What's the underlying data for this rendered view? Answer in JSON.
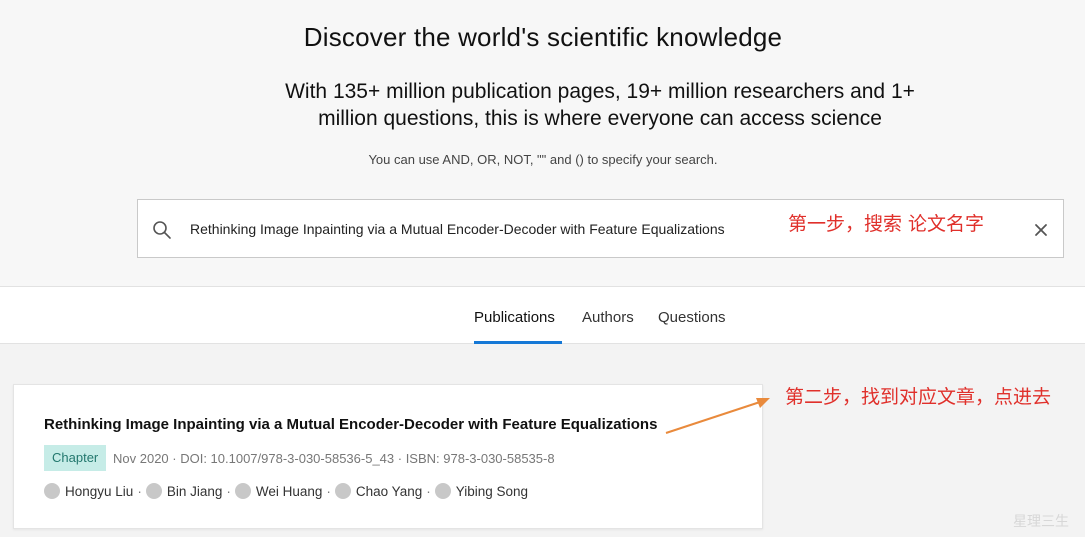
{
  "hero": {
    "title": "Discover the world's scientific knowledge",
    "subtitle": "With 135+ million publication pages, 19+ million researchers and 1+ million questions, this is where everyone can access science",
    "hint": "You can use AND, OR, NOT, \"\" and () to specify your search."
  },
  "search": {
    "value": "Rethinking Image Inpainting via a Mutual Encoder-Decoder with Feature Equalizations",
    "icon": "search-icon",
    "clear_icon": "close-icon"
  },
  "annotations": {
    "step1": "第一步，搜索 论文名字",
    "step2": "第二步，找到对应文章，点进去",
    "arrow_color": "#e98a3c"
  },
  "tabs": {
    "publications": "Publications",
    "authors": "Authors",
    "questions": "Questions",
    "active": "Publications",
    "accent": "#1578d6"
  },
  "result": {
    "title": "Rethinking Image Inpainting via a Mutual Encoder-Decoder with Feature Equalizations",
    "badge": "Chapter",
    "meta": "Nov 2020 · DOI: 10.1007/978-3-030-58536-5_43 · ISBN: 978-3-030-58535-8",
    "authors": [
      "Hongyu Liu",
      "Bin Jiang",
      "Wei Huang",
      "Chao Yang",
      "Yibing Song"
    ],
    "badge_bg": "#c6ece7",
    "badge_fg": "#23786e"
  },
  "watermark": "星理三生"
}
